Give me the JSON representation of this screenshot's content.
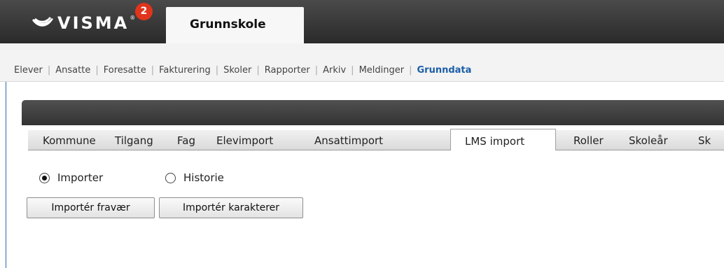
{
  "header": {
    "logo_text": "VISMA",
    "logo_reg": "®",
    "notification_count": "2",
    "app_tab": "Grunnskole"
  },
  "main_nav": {
    "items": [
      "Elever",
      "Ansatte",
      "Foresatte",
      "Fakturering",
      "Skoler",
      "Rapporter",
      "Arkiv",
      "Meldinger",
      "Grunndata"
    ],
    "active": "Grunndata",
    "separator": "|"
  },
  "sub_tabs": {
    "items": [
      "Kommune",
      "Tilgang",
      "Fag",
      "Elevimport",
      "Ansattimport",
      "LMS import",
      "Roller",
      "Skoleår",
      "Sk"
    ],
    "active": "LMS import"
  },
  "radios": {
    "import_label": "Importer",
    "history_label": "Historie",
    "selected": "Importer"
  },
  "buttons": {
    "import_absence": "Importér fravær",
    "import_grades": "Importér karakterer"
  },
  "colors": {
    "accent": "#1c5ea8",
    "badge": "#e0341c",
    "topbar": "#333333"
  }
}
